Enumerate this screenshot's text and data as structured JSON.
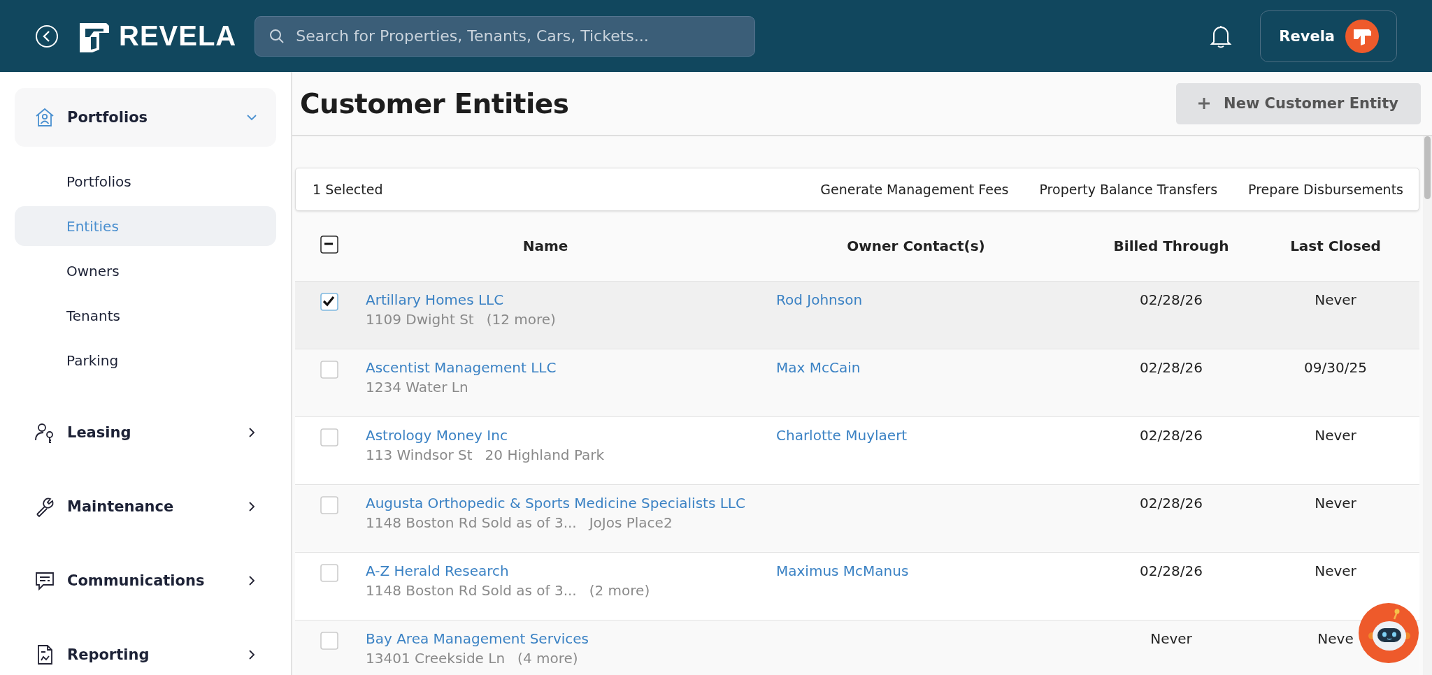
{
  "header": {
    "logo_text": "REVELA",
    "search": {
      "placeholder": "Search for Properties, Tenants, Cars, Tickets..."
    },
    "account": {
      "label": "Revela"
    }
  },
  "sidebar": {
    "items": [
      {
        "label": "Portfolios",
        "kind": "portfolio",
        "expanded": true,
        "children": [
          {
            "label": "Portfolios",
            "selected": false
          },
          {
            "label": "Entities",
            "selected": true
          },
          {
            "label": "Owners",
            "selected": false
          },
          {
            "label": "Tenants",
            "selected": false
          },
          {
            "label": "Parking",
            "selected": false
          }
        ]
      },
      {
        "label": "Leasing",
        "kind": "leasing",
        "expanded": false
      },
      {
        "label": "Maintenance",
        "kind": "maintenance",
        "expanded": false
      },
      {
        "label": "Communications",
        "kind": "communications",
        "expanded": false
      },
      {
        "label": "Reporting",
        "kind": "reporting",
        "expanded": false
      }
    ]
  },
  "page": {
    "title": "Customer Entities",
    "new_button": "New Customer Entity"
  },
  "selection_bar": {
    "count": "1 Selected",
    "actions": [
      "Generate Management Fees",
      "Property Balance Transfers",
      "Prepare Disbursements"
    ]
  },
  "table": {
    "select_all": {
      "checked": false,
      "indeterminate": true
    },
    "columns": [
      "Name",
      "Owner Contact(s)",
      "Billed Through",
      "Last Closed"
    ],
    "rows": [
      {
        "selected": true,
        "name": "Artillary Homes LLC",
        "addresses": [
          "1109 Dwight St",
          "(12 more)"
        ],
        "owner": "Rod Johnson",
        "billed_through": "02/28/26",
        "last_closed": "Never"
      },
      {
        "selected": false,
        "name": "Ascentist Management LLC",
        "addresses": [
          "1234 Water Ln"
        ],
        "owner": "Max McCain",
        "billed_through": "02/28/26",
        "last_closed": "09/30/25"
      },
      {
        "selected": false,
        "name": "Astrology Money Inc",
        "addresses": [
          "113 Windsor St",
          "20 Highland Park"
        ],
        "owner": "Charlotte Muylaert",
        "billed_through": "02/28/26",
        "last_closed": "Never"
      },
      {
        "selected": false,
        "name": "Augusta Orthopedic & Sports Medicine Specialists LLC",
        "addresses": [
          "1148 Boston Rd Sold as of 3...",
          "JoJos Place2"
        ],
        "billed_through": "02/28/26",
        "last_closed": "Never"
      },
      {
        "selected": false,
        "name": "A-Z Herald Research",
        "addresses": [
          "1148 Boston Rd Sold as of 3...",
          "(2 more)"
        ],
        "owner": "Maximus McManus",
        "billed_through": "02/28/26",
        "last_closed": "Never"
      },
      {
        "selected": false,
        "name": "Bay Area Management Services",
        "addresses": [
          "13401 Creekside Ln",
          "(4 more)"
        ],
        "billed_through": "Never",
        "last_closed": "Neve"
      }
    ]
  }
}
